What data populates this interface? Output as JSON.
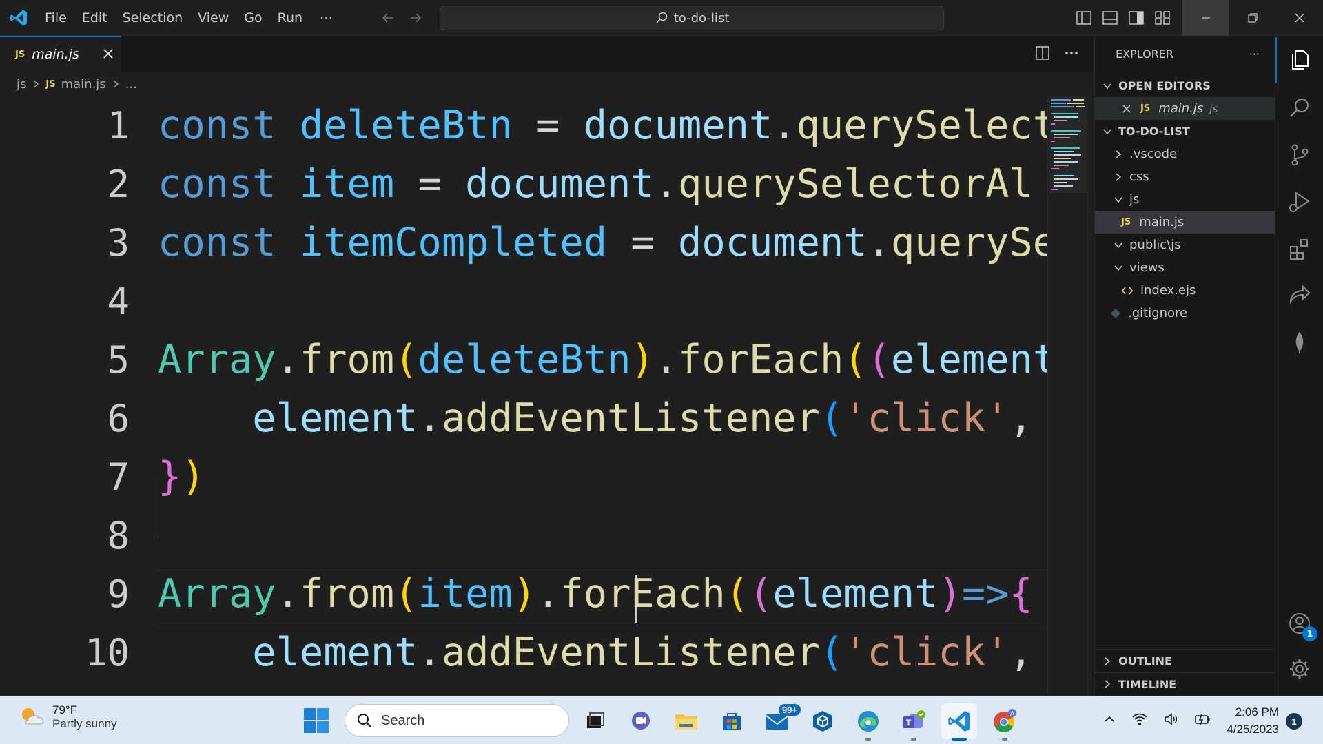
{
  "app": {
    "menu": [
      "File",
      "Edit",
      "Selection",
      "View",
      "Go",
      "Run"
    ],
    "menu_more": "···",
    "command_center": "to-do-list"
  },
  "tabs": [
    {
      "badge": "JS",
      "label": "main.js",
      "active": true
    }
  ],
  "breadcrumb": {
    "folder": "js",
    "file_badge": "JS",
    "file": "main.js",
    "tail": "..."
  },
  "editor": {
    "line_numbers": [
      "1",
      "2",
      "3",
      "4",
      "5",
      "6",
      "7",
      "8",
      "9",
      "10"
    ],
    "lines": [
      [
        [
          "kw",
          "const"
        ],
        [
          "op",
          " "
        ],
        [
          "const",
          "deleteBtn"
        ],
        [
          "op",
          " = "
        ],
        [
          "var",
          "document"
        ],
        [
          "op",
          "."
        ],
        [
          "fn",
          "querySelect"
        ]
      ],
      [
        [
          "kw",
          "const"
        ],
        [
          "op",
          " "
        ],
        [
          "const",
          "item"
        ],
        [
          "op",
          " = "
        ],
        [
          "var",
          "document"
        ],
        [
          "op",
          "."
        ],
        [
          "fn",
          "querySelectorAl"
        ]
      ],
      [
        [
          "kw",
          "const"
        ],
        [
          "op",
          " "
        ],
        [
          "const",
          "itemCompleted"
        ],
        [
          "op",
          " = "
        ],
        [
          "var",
          "document"
        ],
        [
          "op",
          "."
        ],
        [
          "fn",
          "querySe"
        ]
      ],
      [],
      [
        [
          "cls",
          "Array"
        ],
        [
          "op",
          "."
        ],
        [
          "fn",
          "from"
        ],
        [
          "p1",
          "("
        ],
        [
          "const",
          "deleteBtn"
        ],
        [
          "p1",
          ")"
        ],
        [
          "op",
          "."
        ],
        [
          "fn",
          "forEach"
        ],
        [
          "p1",
          "("
        ],
        [
          "p2",
          "("
        ],
        [
          "var",
          "element"
        ]
      ],
      [
        [
          "op",
          "    "
        ],
        [
          "var",
          "element"
        ],
        [
          "op",
          "."
        ],
        [
          "fn",
          "addEventListener"
        ],
        [
          "p3",
          "("
        ],
        [
          "str",
          "'click'"
        ],
        [
          "op",
          ","
        ]
      ],
      [
        [
          "p2",
          "}"
        ],
        [
          "p1",
          ")"
        ]
      ],
      [],
      [
        [
          "cls",
          "Array"
        ],
        [
          "op",
          "."
        ],
        [
          "fn",
          "from"
        ],
        [
          "p1",
          "("
        ],
        [
          "const",
          "item"
        ],
        [
          "p1",
          ")"
        ],
        [
          "op",
          "."
        ],
        [
          "fn",
          "forEach"
        ],
        [
          "p1",
          "("
        ],
        [
          "p2",
          "("
        ],
        [
          "var",
          "element"
        ],
        [
          "p2",
          ")"
        ],
        [
          "arrow",
          "=>"
        ],
        [
          "p2",
          "{"
        ]
      ],
      [
        [
          "op",
          "    "
        ],
        [
          "var",
          "element"
        ],
        [
          "op",
          "."
        ],
        [
          "fn",
          "addEventListener"
        ],
        [
          "p3",
          "("
        ],
        [
          "str",
          "'click'"
        ],
        [
          "op",
          ","
        ]
      ]
    ]
  },
  "explorer": {
    "title": "EXPLORER",
    "more": "···",
    "open_editors_label": "OPEN EDITORS",
    "open_editor": {
      "badge": "JS",
      "name": "main.js",
      "folder": "js"
    },
    "project_label": "TO-DO-LIST",
    "tree": [
      {
        "type": "folder",
        "name": ".vscode",
        "expanded": false
      },
      {
        "type": "folder",
        "name": "css",
        "expanded": false
      },
      {
        "type": "folder",
        "name": "js",
        "expanded": true
      },
      {
        "type": "file-js",
        "badge": "JS",
        "name": "main.js"
      },
      {
        "type": "folder",
        "name": "public\\js",
        "expanded": true
      },
      {
        "type": "folder",
        "name": "views",
        "expanded": true
      },
      {
        "type": "file-ejs",
        "name": "index.ejs"
      },
      {
        "type": "file-git",
        "name": ".gitignore"
      }
    ],
    "outline_label": "OUTLINE",
    "timeline_label": "TIMELINE"
  },
  "activity_bar": {
    "accounts_badge": "1"
  },
  "taskbar": {
    "weather_temp": "79°F",
    "weather_desc": "Partly sunny",
    "search_placeholder": "Search",
    "mail_badge": "99+",
    "time": "2:06 PM",
    "date": "4/25/2023",
    "notifications": "1"
  },
  "colors": {
    "accent": "#0078d4",
    "editor_bg": "#1f1f1f",
    "js_badge": "#e8d44d"
  }
}
